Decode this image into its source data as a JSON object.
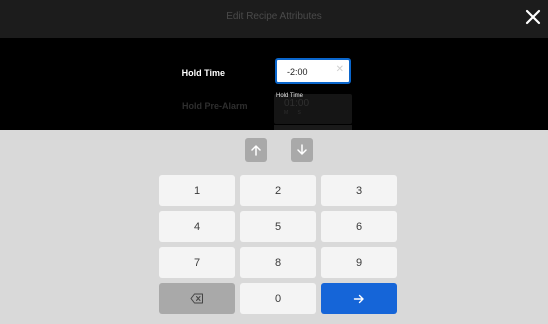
{
  "header": {
    "title": "Edit Recipe Attributes",
    "close_icon": "close-icon"
  },
  "form": {
    "hold_time_label": "Hold Time",
    "hold_time_value": "-2:00",
    "hold_prealarm_label": "Hold Pre-Alarm",
    "tooltip": {
      "label": "Hold Time",
      "time": "01:00",
      "units": "M S"
    }
  },
  "keypad": {
    "up_icon": "arrow-up-icon",
    "down_icon": "arrow-down-icon",
    "keys": [
      "1",
      "2",
      "3",
      "4",
      "5",
      "6",
      "7",
      "8",
      "9"
    ],
    "backspace_icon": "backspace-icon",
    "zero": "0",
    "enter_icon": "arrow-right-icon"
  },
  "colors": {
    "accent": "#1565d8",
    "keyboard_bg": "#d9d9d9"
  }
}
